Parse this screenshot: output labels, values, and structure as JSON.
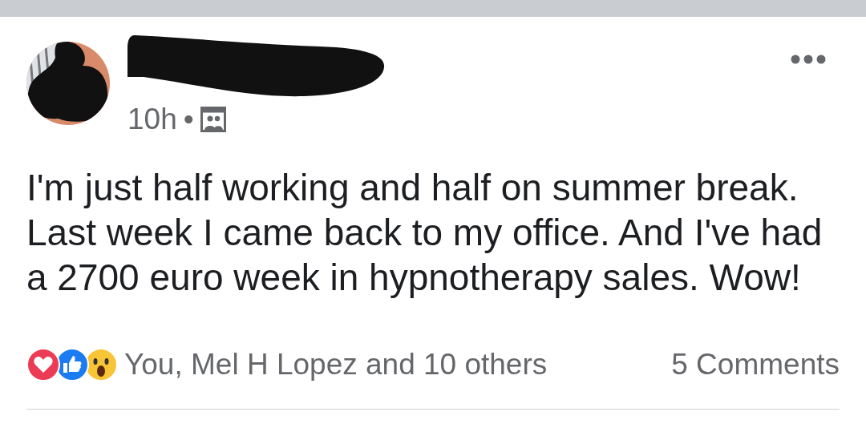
{
  "post": {
    "time": "10h",
    "separator": "•",
    "body": "I'm just half working and half on summer break. Last week I came back to my office. And I've had a 2700 euro week in hypnotherapy sales. Wow!",
    "reactions_summary": "You, Mel H Lopez and 10 others",
    "comments": "5 Comments"
  }
}
